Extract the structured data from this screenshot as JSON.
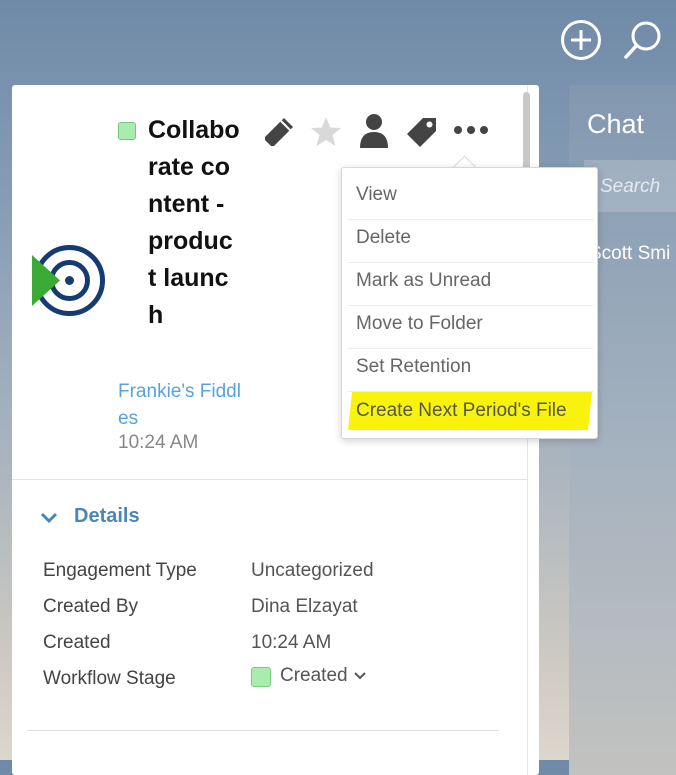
{
  "header": {
    "add_icon": "plus-circle-icon",
    "search_icon": "search-icon"
  },
  "chat": {
    "title": "Chat",
    "search_placeholder": "Search",
    "contact_name": "Scott Smi"
  },
  "file": {
    "title": "Collaborate content - product launch",
    "client_name": "Frankie's Fiddles",
    "time": "10:24 AM",
    "status_color": "#a9ecae"
  },
  "actions": {
    "icons": [
      "pencil-icon",
      "star-icon",
      "person-icon",
      "tag-icon",
      "more-icon"
    ]
  },
  "menu": {
    "items": [
      "View",
      "Delete",
      "Mark as Unread",
      "Move to Folder",
      "Set Retention",
      "Create Next Period's File"
    ],
    "highlight_color": "#f9f30c"
  },
  "details": {
    "label": "Details",
    "rows": [
      {
        "label": "Engagement Type",
        "value": "Uncategorized"
      },
      {
        "label": "Created By",
        "value": "Dina Elzayat"
      },
      {
        "label": "Created",
        "value": "10:24 AM"
      },
      {
        "label": "Workflow Stage",
        "value": "Created"
      }
    ]
  },
  "colors": {
    "link": "#58a3d8",
    "details_header": "#4a87b8",
    "logo_blue": "#163b73",
    "logo_green": "#3aa935"
  }
}
